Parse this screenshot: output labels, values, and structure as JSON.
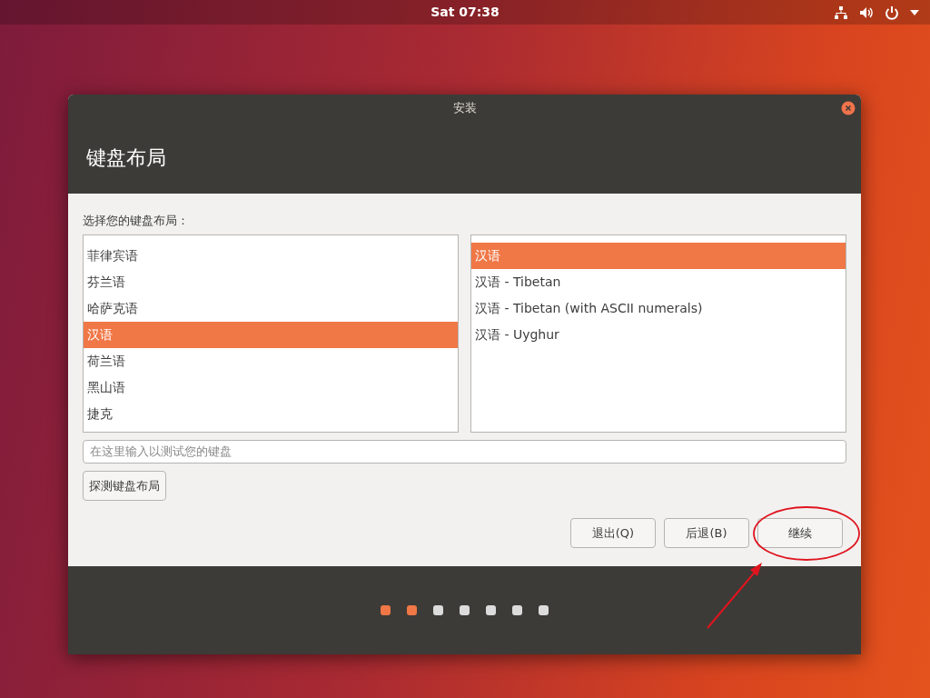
{
  "top_bar": {
    "clock": "Sat 07:38"
  },
  "window": {
    "title": "安装",
    "heading": "键盘布局"
  },
  "prompt": "选择您的键盘布局：",
  "layouts": [
    {
      "label": "菲律宾语",
      "selected": false
    },
    {
      "label": "芬兰语",
      "selected": false
    },
    {
      "label": "哈萨克语",
      "selected": false
    },
    {
      "label": "汉语",
      "selected": true
    },
    {
      "label": "荷兰语",
      "selected": false
    },
    {
      "label": "黑山语",
      "selected": false
    },
    {
      "label": "捷克",
      "selected": false
    }
  ],
  "variants": [
    {
      "label": "汉语",
      "selected": true
    },
    {
      "label": "汉语 - Tibetan",
      "selected": false
    },
    {
      "label": "汉语 - Tibetan (with ASCII numerals)",
      "selected": false
    },
    {
      "label": "汉语 - Uyghur",
      "selected": false
    }
  ],
  "test_field": {
    "placeholder": "在这里输入以测试您的键盘"
  },
  "detect_button": "探测键盘布局",
  "buttons": [
    "退出(Q)",
    "后退(B)",
    "继续"
  ],
  "steps": [
    {
      "done": true
    },
    {
      "done": true
    },
    {
      "done": false
    },
    {
      "done": false
    },
    {
      "done": false
    },
    {
      "done": false
    },
    {
      "done": false
    }
  ]
}
